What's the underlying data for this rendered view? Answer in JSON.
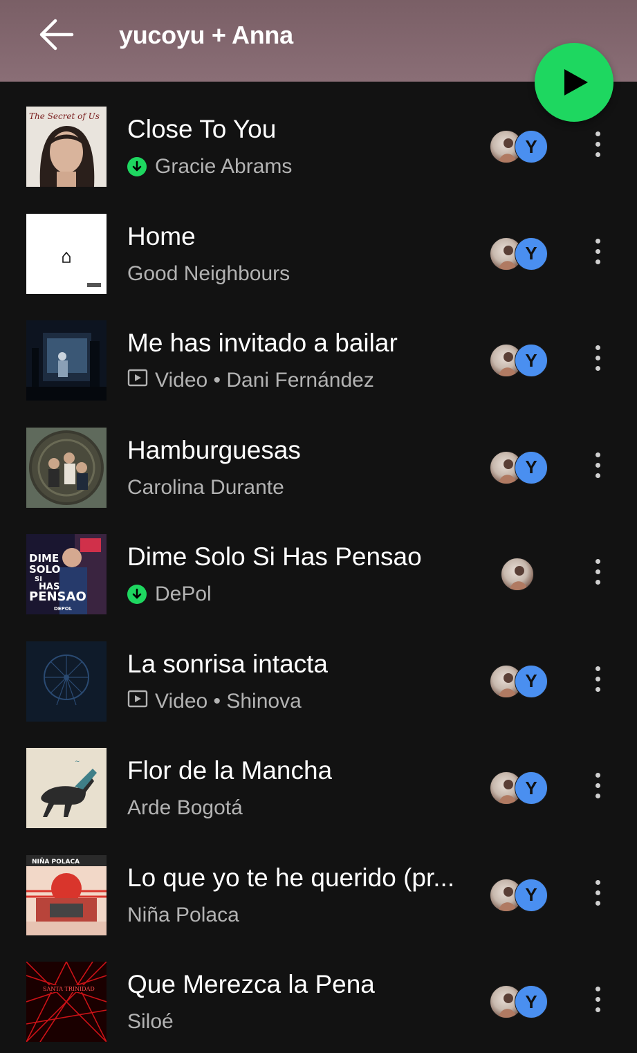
{
  "header": {
    "title": "yucoyu + Anna"
  },
  "colors": {
    "accent": "#1ed760",
    "header_bg": "#7a5f66",
    "background": "#121212",
    "subtext": "#b3b3b3",
    "avatar_y": "#4a8ff0"
  },
  "avatar_letter": "Y",
  "tracks": [
    {
      "title": "Close To You",
      "subtitle": "Gracie Abrams",
      "downloaded": true,
      "video": false,
      "avatars": 2
    },
    {
      "title": "Home",
      "subtitle": "Good Neighbours",
      "downloaded": false,
      "video": false,
      "avatars": 2
    },
    {
      "title": "Me has invitado a bailar",
      "subtitle": "Video • Dani Fernández",
      "downloaded": false,
      "video": true,
      "avatars": 2
    },
    {
      "title": "Hamburguesas",
      "subtitle": "Carolina Durante",
      "downloaded": false,
      "video": false,
      "avatars": 2
    },
    {
      "title": "Dime Solo Si Has Pensao",
      "subtitle": "DePol",
      "downloaded": true,
      "video": false,
      "avatars": 1
    },
    {
      "title": "La sonrisa intacta",
      "subtitle": "Video • Shinova",
      "downloaded": false,
      "video": true,
      "avatars": 2
    },
    {
      "title": "Flor de la Mancha",
      "subtitle": "Arde Bogotá",
      "downloaded": false,
      "video": false,
      "avatars": 2
    },
    {
      "title": "Lo que yo te he querido (pr...",
      "subtitle": "Niña Polaca",
      "downloaded": false,
      "video": false,
      "avatars": 2
    },
    {
      "title": "Que Merezca la Pena",
      "subtitle": "Siloé",
      "downloaded": false,
      "video": false,
      "avatars": 2
    }
  ],
  "cover_text": {
    "cover0": "The Secret of Us",
    "cover4_lines": [
      "DIME",
      "SOLO",
      "SI",
      "HAS",
      "PENSAO"
    ],
    "cover4_small": "DEPOL",
    "cover7": "NIÑA POLACA",
    "cover8": "SANTA TRINIDAD"
  },
  "icons": {
    "back": "arrow-left-icon",
    "play": "play-icon",
    "download": "download-arrow-icon",
    "video": "video-icon",
    "more": "more-vertical-icon"
  }
}
